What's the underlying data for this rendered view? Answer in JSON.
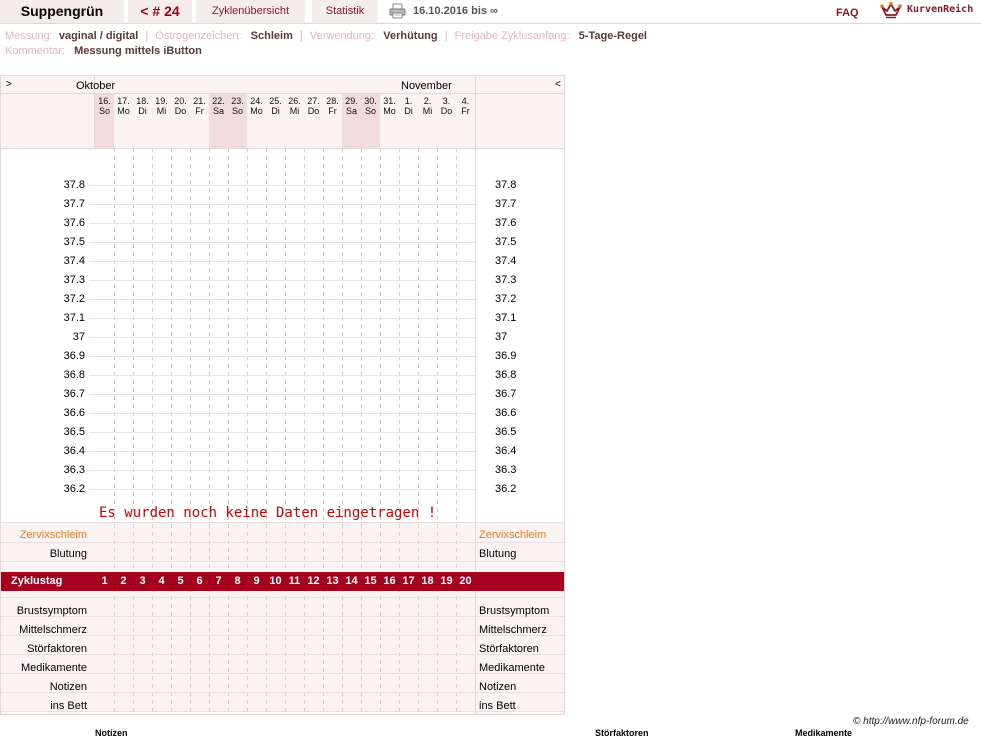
{
  "header": {
    "user_name": "Suppengrün",
    "cycle_label": "< # 24",
    "tab_overview": "Zyklenübersicht",
    "tab_stats": "Statistik",
    "date_range": "16.10.2016 bis ∞",
    "faq": "FAQ",
    "brand": "KurvenReich",
    "print_icon": "printer-icon",
    "brand_icon": "crown-icon"
  },
  "meta": {
    "measurement_key": "Messung:",
    "measurement_val": "vaginal / digital",
    "estrogen_key": "Östrogenzeichen:",
    "estrogen_val": "Schleim",
    "usage_key": "Verwendung:",
    "usage_val": "Verhütung",
    "release_key": "Freigabe Zyklusanfang:",
    "release_val": "5-Tage-Regel",
    "comment_key": "Kommentar:",
    "comment_val": "Messung mittels iButton"
  },
  "chart": {
    "nav_prev": ">",
    "nav_next": "<",
    "month_1": "Oktober",
    "month_2": "November",
    "days": [
      {
        "d": "16.",
        "w": "So",
        "we": true
      },
      {
        "d": "17.",
        "w": "Mo",
        "we": false
      },
      {
        "d": "18.",
        "w": "Di",
        "we": false
      },
      {
        "d": "19.",
        "w": "Mi",
        "we": false
      },
      {
        "d": "20.",
        "w": "Do",
        "we": false
      },
      {
        "d": "21.",
        "w": "Fr",
        "we": false
      },
      {
        "d": "22.",
        "w": "Sa",
        "we": true
      },
      {
        "d": "23.",
        "w": "So",
        "we": true
      },
      {
        "d": "24.",
        "w": "Mo",
        "we": false
      },
      {
        "d": "25.",
        "w": "Di",
        "we": false
      },
      {
        "d": "26.",
        "w": "Mi",
        "we": false
      },
      {
        "d": "27.",
        "w": "Do",
        "we": false
      },
      {
        "d": "28.",
        "w": "Fr",
        "we": false
      },
      {
        "d": "29.",
        "w": "Sa",
        "we": true
      },
      {
        "d": "30.",
        "w": "So",
        "we": true
      },
      {
        "d": "31.",
        "w": "Mo",
        "we": false
      },
      {
        "d": "1.",
        "w": "Di",
        "we": false
      },
      {
        "d": "2.",
        "w": "Mi",
        "we": false
      },
      {
        "d": "3.",
        "w": "Do",
        "we": false
      },
      {
        "d": "4.",
        "w": "Fr",
        "we": false
      }
    ],
    "temperatures": [
      "37.8",
      "37.7",
      "37.6",
      "37.5",
      "37.4",
      "37.3",
      "37.2",
      "37.1",
      "37",
      "36.9",
      "36.8",
      "36.7",
      "36.6",
      "36.5",
      "36.4",
      "36.3",
      "36.2"
    ],
    "no_data": "Es wurden noch keine Daten eingetragen !",
    "row_cervix": "Zervixschleim",
    "row_bleeding": "Blutung",
    "cycleday_label": "Zyklustag",
    "cycledays": [
      "1",
      "2",
      "3",
      "4",
      "5",
      "6",
      "7",
      "8",
      "9",
      "10",
      "11",
      "12",
      "13",
      "14",
      "15",
      "16",
      "17",
      "18",
      "19",
      "20"
    ],
    "lower_rows": [
      "Brustsymptom",
      "Mittelschmerz",
      "Störfaktoren",
      "Medikamente",
      "Notizen",
      "ins Bett"
    ]
  },
  "footer": {
    "copyright": "© http://www.nfp-forum.de",
    "col_notes": "Notizen",
    "col_disturb": "Störfaktoren",
    "col_meds": "Medikamente"
  },
  "colors": {
    "accent": "#a5001e",
    "panel_bg": "#faf3f3",
    "weekend_bg": "#f0dcdc",
    "label_muted": "#e3b5bc",
    "cervix_orange": "#e87b1a"
  }
}
